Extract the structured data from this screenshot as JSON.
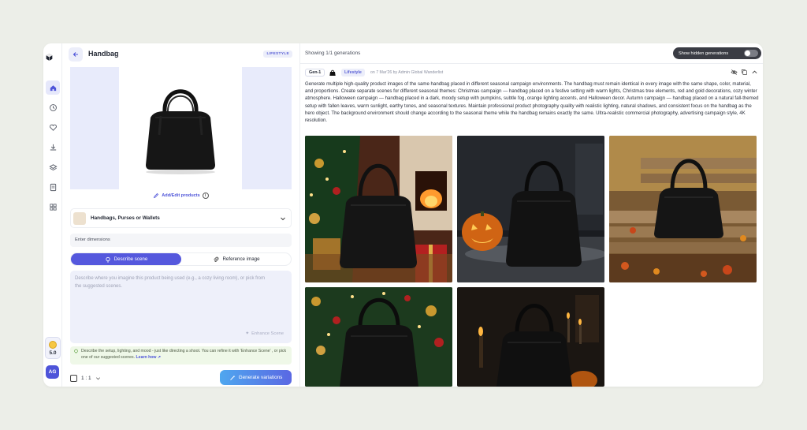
{
  "sidebar": {
    "icons": [
      "home-icon",
      "history-icon",
      "heart-icon",
      "download-icon",
      "layers-icon",
      "document-icon",
      "grid-icon"
    ],
    "credits": "5.0",
    "avatar_initials": "AG"
  },
  "panel": {
    "title": "Handbag",
    "tag": "LIFESTYLE",
    "add_edit_label": "Add/Edit products",
    "info_symbol": "i",
    "category": "Handbags, Purses or Wallets",
    "dimensions_placeholder": "Enter dimensions",
    "tabs": [
      {
        "label": "Describe scene",
        "active": true
      },
      {
        "label": "Reference image",
        "active": false
      }
    ],
    "scene_placeholder": "Describe where you imagine this product being used (e.g., a cozy living room), or pick from the suggested scenes.",
    "enhance_label": "Enhance Scene",
    "hint_text": "Describe the setup, lighting, and mood - just like directing a shoot. You can refine it with 'Enhance Scene' , or pick one of our suggested scenes.",
    "hint_link": "Learn how",
    "ratio": "1 : 1",
    "generate_label": "Generate variations"
  },
  "results": {
    "showing": "Showing 1/1 generations",
    "toggle_label": "Show hidden generations",
    "toggle_on": false,
    "gen_badge": "Gen-1",
    "lifestyle_badge": "Lifestyle",
    "meta": "on 7 Mar'26 by Admin Global Wanderlist",
    "prompt": "Generate multiple high-quality product images of the same handbag placed in different seasonal campaign environments. The handbag must remain identical in every image with the same shape, color, material, and proportions. Create separate scenes for different seasonal themes: Christmas campaign — handbag placed on a festive setting with warm lights, Christmas tree elements, red and gold decorations, cozy winter atmosphere. Halloween campaign — handbag placed in a dark, moody setup with pumpkins, subtle fog, orange lighting accents, and Halloween decor. Autumn campaign — handbag placed on a natural fall-themed setup with fallen leaves, warm sunlight, earthy tones, and seasonal textures. Maintain professional product photography quality with realistic lighting, natural shadows, and consistent focus on the handbag as the hero object. The background environment should change according to the seasonal theme while the handbag remains exactly the same. Ultra-realistic commercial photography, advertising campaign style, 4K resolution.",
    "images": [
      "christmas",
      "halloween",
      "autumn",
      "christmas-tree",
      "halloween-candles"
    ]
  },
  "colors": {
    "accent": "#5558dd",
    "background": "#eceee8",
    "avatar": "#4e54d9"
  }
}
